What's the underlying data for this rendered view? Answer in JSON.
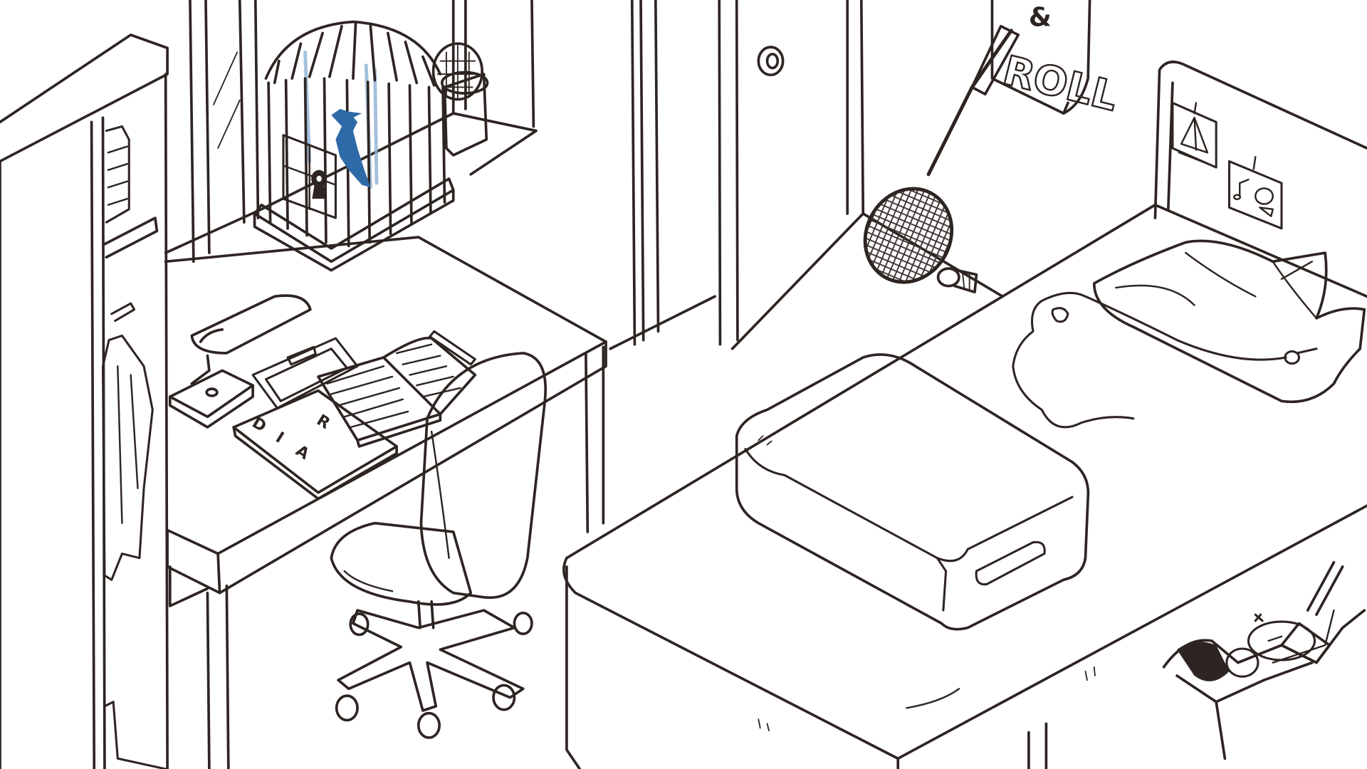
{
  "scene": {
    "room": "bedroom",
    "style": "hand-drawn sketch"
  },
  "colors": {
    "background": "#ffffff",
    "ink": "#2e2522",
    "bird": "#2f6aa8",
    "cage_shadow": "#8fb0d4",
    "pillow_shade": "#efefef",
    "racket_grid": "#3a3230"
  },
  "poster": {
    "top_text": "&",
    "main_text": "ROLL"
  },
  "diary": {
    "letters": [
      "D",
      "I",
      "A",
      "R"
    ]
  },
  "icons": {
    "bird": "bird-icon",
    "keyhole": "keyhole-icon",
    "music_note": "music-note-icon",
    "tent": "tent-icon"
  }
}
